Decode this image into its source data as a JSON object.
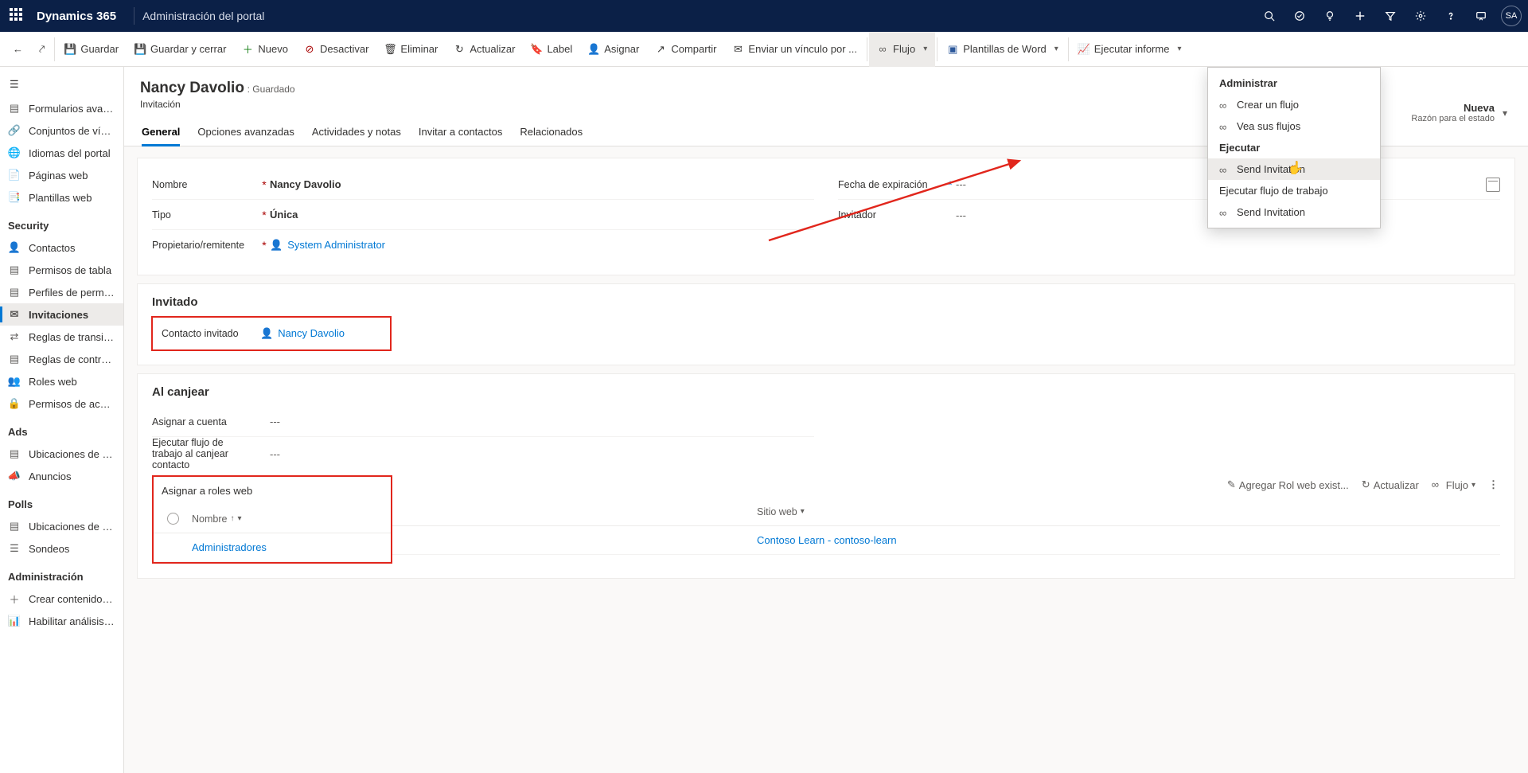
{
  "topbar": {
    "brand": "Dynamics 365",
    "area": "Administración del portal",
    "avatar": "SA"
  },
  "cmdbar": {
    "save": "Guardar",
    "save_close": "Guardar y cerrar",
    "new": "Nuevo",
    "deactivate": "Desactivar",
    "delete": "Eliminar",
    "refresh": "Actualizar",
    "label": "Label",
    "assign": "Asignar",
    "share": "Compartir",
    "email_link": "Enviar un vínculo por ...",
    "flow": "Flujo",
    "word_templates": "Plantillas de Word",
    "run_report": "Ejecutar informe"
  },
  "leftnav": {
    "general": [
      "Formularios avanz...",
      "Conjuntos de vínc...",
      "Idiomas del portal",
      "Páginas web",
      "Plantillas web"
    ],
    "security_hdr": "Security",
    "security": [
      "Contactos",
      "Permisos de tabla",
      "Perfiles de permis...",
      "Invitaciones",
      "Reglas de transici...",
      "Reglas de control ...",
      "Roles web",
      "Permisos de acces..."
    ],
    "ads_hdr": "Ads",
    "ads": [
      "Ubicaciones de a...",
      "Anuncios"
    ],
    "polls_hdr": "Polls",
    "polls": [
      "Ubicaciones de so...",
      "Sondeos"
    ],
    "admin_hdr": "Administración",
    "admin": [
      "Crear contenido d...",
      "Habilitar análisis ..."
    ]
  },
  "header": {
    "title": "Nancy Davolio",
    "saved": ": Guardado",
    "entity": "Invitación",
    "state_label": "Nueva",
    "state_reason": "Razón para el estado"
  },
  "tabs": [
    "General",
    "Opciones avanzadas",
    "Actividades y notas",
    "Invitar a contactos",
    "Relacionados"
  ],
  "fields": {
    "name_lbl": "Nombre",
    "name_val": "Nancy Davolio",
    "type_lbl": "Tipo",
    "type_val": "Única",
    "owner_lbl": "Propietario/remitente",
    "owner_val": "System Administrator",
    "expiry_lbl": "Fecha de expiración",
    "expiry_val": "---",
    "inviter_lbl": "Invitador",
    "inviter_val": "---"
  },
  "invitee": {
    "section": "Invitado",
    "contact_lbl": "Contacto invitado",
    "contact_val": "Nancy Davolio"
  },
  "redeem": {
    "section": "Al canjear",
    "assign_account_lbl": "Asignar a cuenta",
    "assign_account_val": "---",
    "run_workflow_lbl": "Ejecutar flujo de trabajo al canjear contacto",
    "run_workflow_val": "---",
    "assign_roles_lbl": "Asignar a roles web",
    "subcmd_add": "Agregar Rol web exist...",
    "subcmd_refresh": "Actualizar",
    "subcmd_flow": "Flujo",
    "grid_col_name": "Nombre",
    "grid_col_site": "Sitio web",
    "row_name": "Administradores",
    "row_site": "Contoso Learn - contoso-learn"
  },
  "flyout": {
    "manage": "Administrar",
    "create_flow": "Crear un flujo",
    "see_flows": "Vea sus flujos",
    "run": "Ejecutar",
    "send_inv_1": "Send Invitation",
    "run_wf": "Ejecutar flujo de trabajo",
    "send_inv_2": "Send Invitation"
  }
}
